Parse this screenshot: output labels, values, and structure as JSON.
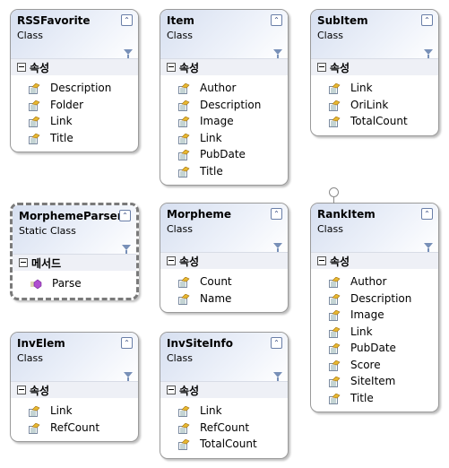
{
  "classes": [
    {
      "name": "RSSFavorite",
      "kind": "Class",
      "section": "속성",
      "member_type": "property",
      "members": [
        "Description",
        "Folder",
        "Link",
        "Title"
      ]
    },
    {
      "name": "Item",
      "kind": "Class",
      "section": "속성",
      "member_type": "property",
      "members": [
        "Author",
        "Description",
        "Image",
        "Link",
        "PubDate",
        "Title"
      ]
    },
    {
      "name": "SubItem",
      "kind": "Class",
      "section": "속성",
      "member_type": "property",
      "members": [
        "Link",
        "OriLink",
        "TotalCount"
      ]
    },
    {
      "name": "MorphemeParser",
      "kind": "Static Class",
      "section": "메서드",
      "member_type": "method",
      "members": [
        "Parse"
      ]
    },
    {
      "name": "Morpheme",
      "kind": "Class",
      "section": "속성",
      "member_type": "property",
      "members": [
        "Count",
        "Name"
      ]
    },
    {
      "name": "RankItem",
      "kind": "Class",
      "section": "속성",
      "member_type": "property",
      "members": [
        "Author",
        "Description",
        "Image",
        "Link",
        "PubDate",
        "Score",
        "SiteItem",
        "Title"
      ],
      "has_interface_lollipop": true
    },
    {
      "name": "InvElem",
      "kind": "Class",
      "section": "속성",
      "member_type": "property",
      "members": [
        "Link",
        "RefCount"
      ]
    },
    {
      "name": "InvSiteInfo",
      "kind": "Class",
      "section": "속성",
      "member_type": "property",
      "members": [
        "Link",
        "RefCount",
        "TotalCount"
      ]
    }
  ],
  "icons": {
    "collapse": "double-chevron-up-icon",
    "filter": "filter-icon",
    "property": "property-icon",
    "method": "method-icon"
  }
}
